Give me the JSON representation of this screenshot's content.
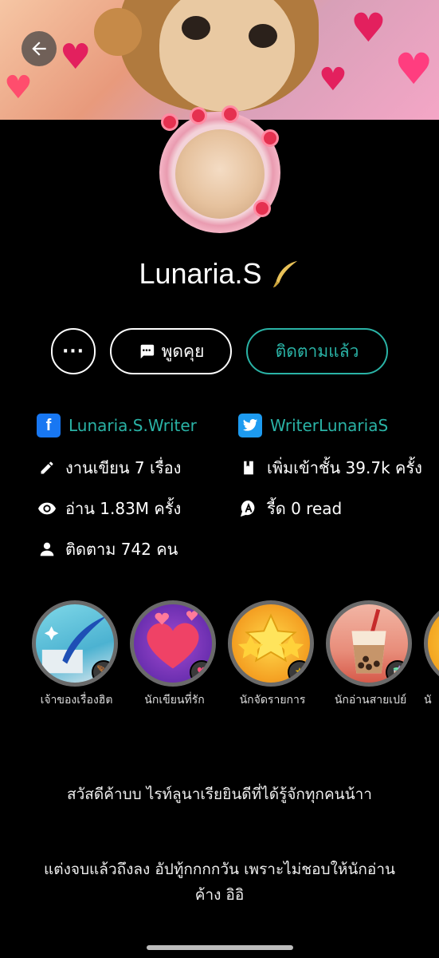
{
  "profile": {
    "name": "Lunaria.S",
    "verified_icon": "quill-icon"
  },
  "actions": {
    "more_label": "···",
    "chat_label": "พูดคุย",
    "follow_label": "ติดตามแล้ว"
  },
  "social": {
    "facebook": "Lunaria.S.Writer",
    "twitter": "WriterLunariaS"
  },
  "stats": {
    "works": "งานเขียน 7 เรื่อง",
    "shelf_adds": "เพิ่มเข้าชั้น 39.7k ครั้ง",
    "reads": "อ่าน 1.83M ครั้ง",
    "ried": "รี้ด 0 read",
    "followers": "ติดตาม 742 คน"
  },
  "badges": [
    {
      "label": "เจ้าของเรื่องฮิต",
      "icon": "quill-icon"
    },
    {
      "label": "นักเขียนที่รัก",
      "icon": "heart-icon"
    },
    {
      "label": "นักจัดรายการ",
      "icon": "star-icon"
    },
    {
      "label": "นักอ่านสายเปย์",
      "icon": "bubble-tea-icon"
    },
    {
      "label": "นั",
      "icon": "warning-icon"
    }
  ],
  "bio": {
    "line1": "สวัสดีค้าบบ ไรท์ลูนาเรียยินดีที่ได้รู้จักทุกคนน้าา",
    "line2": "แต่งจบแล้วถึงลง อัปทู้กกกกวัน เพราะไม่ชอบให้นักอ่านค้าง อิอิ"
  },
  "colors": {
    "accent": "#2ab3a6",
    "facebook": "#1877f2",
    "twitter": "#1d9bf0"
  }
}
